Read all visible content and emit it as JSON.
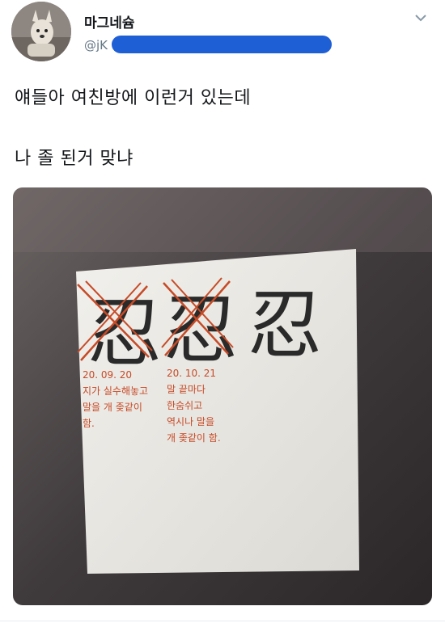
{
  "tweet": {
    "display_name": "마그네슘",
    "handle_prefix": "@jK",
    "text_line1": "얘들아 여친방에 이런거 있는데",
    "text_line2": "나 졸 된거 맞냐"
  },
  "note": {
    "glyph1": "忍",
    "glyph2": "忍",
    "glyph3": "忍",
    "entry1_date": "20. 09. 20",
    "entry1_line1": "지가 실수해놓고",
    "entry1_line2": "말을 개 좆같이",
    "entry1_line3": "함.",
    "entry2_date": "20. 10. 21",
    "entry2_line1": "말 끝마다",
    "entry2_line2": "한숨쉬고",
    "entry2_line3": "역시나 말을",
    "entry2_line4": "개 좆같이 함."
  },
  "colors": {
    "redaction": "#1f5fd6",
    "ink_red": "#c74a26",
    "ink_black": "#2a2a2a",
    "sticky_note": "#ecebe6"
  },
  "icons": {
    "caret": "chevron-down-icon"
  }
}
